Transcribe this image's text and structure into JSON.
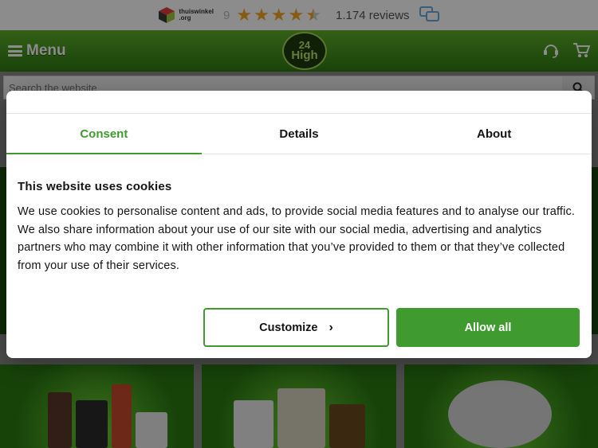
{
  "topbar": {
    "logo_text": "thuiswinkel",
    "logo_sub": ".org",
    "score": "9",
    "rating_stars": 4.5,
    "reviews": "1.174 reviews"
  },
  "nav": {
    "menu_label": "Menu",
    "logo_line1": "24",
    "logo_line2": "High"
  },
  "search": {
    "placeholder": "Search the website"
  },
  "cookie_dialog": {
    "tabs": [
      {
        "label": "Consent",
        "active": true
      },
      {
        "label": "Details",
        "active": false
      },
      {
        "label": "About",
        "active": false
      }
    ],
    "heading": "This website uses cookies",
    "paragraph": "We use cookies to personalise content and ads, to provide social media features and to analyse our traffic. We also share information about your use of our site with our social media, advertising and analytics partners who may combine it with other information that you’ve provided to them or that they’ve collected from your use of their services.",
    "customize_label": "Customize",
    "allow_all_label": "Allow all"
  },
  "colors": {
    "accent": "#3f9a2f",
    "nav_green": "#4a9a22",
    "star": "#f5a623"
  }
}
